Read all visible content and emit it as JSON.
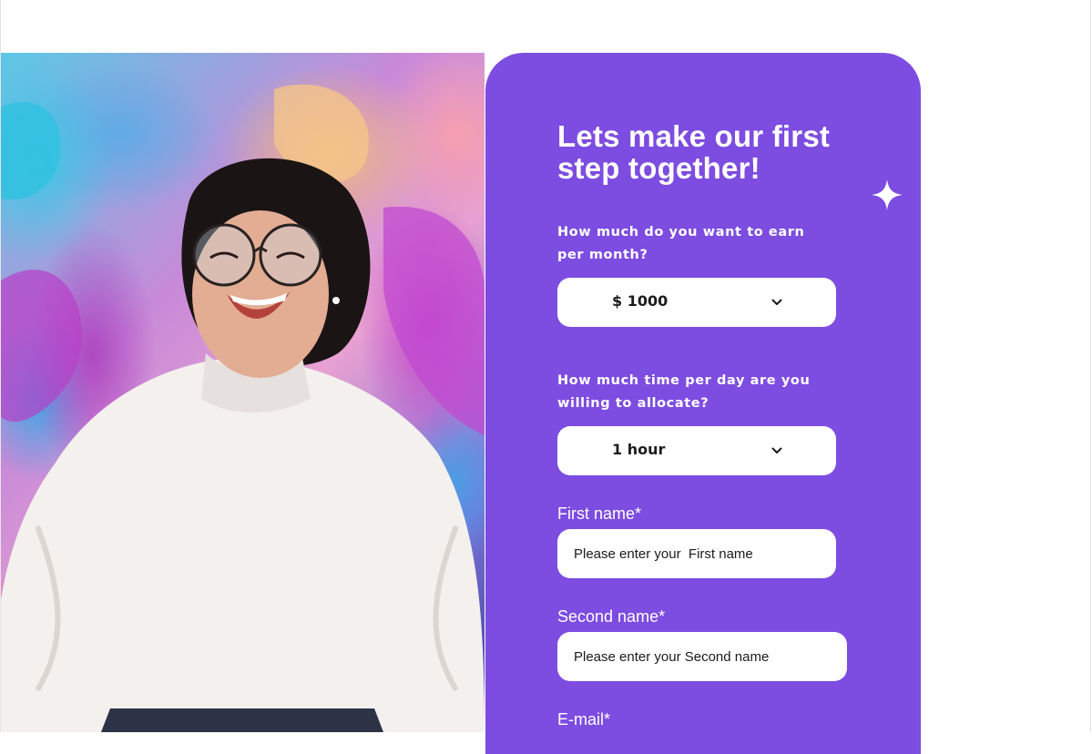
{
  "form": {
    "title": "Lets make our first step together!",
    "earn_question": "How much do you want to earn per month?",
    "earn_value": "$ 1000",
    "time_question": "How much time per day are you willing to allocate?",
    "time_value": "1 hour",
    "first_name_label": "First name*",
    "first_name_placeholder": "Please enter your  First name",
    "second_name_label": "Second name*",
    "second_name_placeholder": "Please enter your Second name",
    "email_label": "E-mail*"
  },
  "icons": {
    "select_chevron": "chevron-down-icon",
    "decoration": "sparkle-icon"
  },
  "colors": {
    "accent": "#7d4ce0",
    "field_bg": "#ffffff",
    "text_on_accent": "#ffffff"
  }
}
